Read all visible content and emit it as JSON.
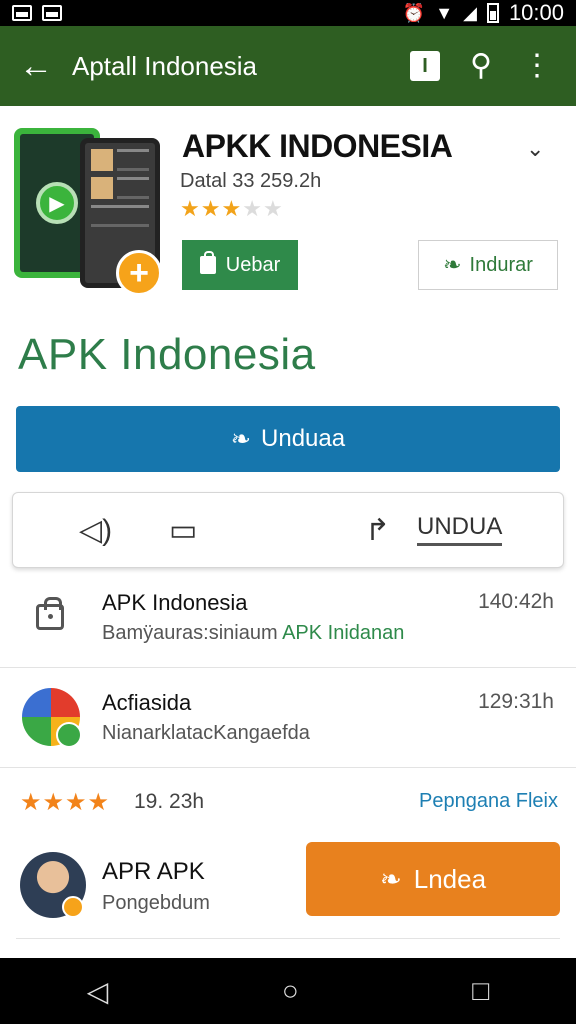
{
  "status_bar": {
    "time": "10:00"
  },
  "app_bar": {
    "back_icon": "arrow-left-icon",
    "title": "Aptall Indonesia",
    "square_label": "I"
  },
  "hero": {
    "title": "APKK INDONESIA",
    "meta": "Datal 33 259.2h",
    "rating": 3,
    "rating_max": 5,
    "primary_button": "Uebar",
    "secondary_button": "Indurar"
  },
  "big_title": "APK Indonesia",
  "main_button": "Unduaa",
  "action_card": {
    "share_label": "UNDUA"
  },
  "list": [
    {
      "icon": "lock-icon",
      "title": "APK Indonesia",
      "sub_prefix": "Bamÿauras:siniaum ",
      "sub_accent": "APK Inidanan",
      "time": "140:42h"
    },
    {
      "icon": "colorful-app-icon",
      "title": "Acfiasida",
      "sub": "NianarklatacKangaefda",
      "time": "129:31h"
    }
  ],
  "rating_row": {
    "stars": 4,
    "text": "19. 23h",
    "link": "Pepngana Fleix"
  },
  "user_row": {
    "title": "APR APK",
    "sub": "Pongebdum",
    "button": "Lndea"
  },
  "colors": {
    "app_bar": "#2e5e22",
    "primary_blue": "#1676ad",
    "orange": "#e8811e",
    "green_button": "#2f8a4a",
    "title_green": "#2e7d4a"
  }
}
